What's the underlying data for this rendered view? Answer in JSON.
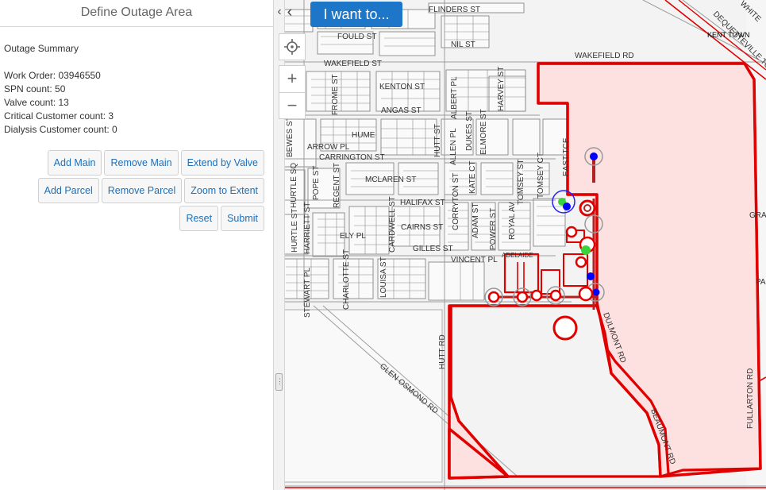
{
  "panel": {
    "title": "Define Outage Area",
    "summary_heading": "Outage Summary",
    "work_order": "Work Order: 03946550",
    "spn_count": "SPN count: 50",
    "valve_count": "Valve count: 13",
    "critical_count": "Critical Customer count: 3",
    "dialysis_count": "Dialysis Customer count: 0"
  },
  "buttons": {
    "add_main": "Add Main",
    "remove_main": "Remove Main",
    "extend_by_valve": "Extend by Valve",
    "add_parcel": "Add Parcel",
    "remove_parcel": "Remove Parcel",
    "zoom_to_extent": "Zoom to Extent",
    "reset": "Reset",
    "submit": "Submit"
  },
  "map": {
    "i_want_to": "I want to...",
    "icons": {
      "back": "chevron-left-icon",
      "locate": "crosshair-icon",
      "zoom_in": "plus-icon",
      "zoom_out": "minus-icon",
      "collapse": "chevron-left-icon",
      "grip": "grip-icon"
    },
    "colors": {
      "outage_fill": "#fde0e0",
      "outage_line": "#e00000",
      "button_blue": "#1d76c7",
      "valve_blue": "#0000ff",
      "valve_green": "#39d43c"
    },
    "street_labels": {
      "flinders": "FLINDERS ST",
      "fould": "FOULD ST",
      "nil": "NIL ST",
      "wakefield_st": "WAKEFIELD ST",
      "wakefield_rd": "WAKEFIELD RD",
      "kenton": "KENTON ST",
      "angas": "ANGAS ST",
      "frome": "FROME ST",
      "harvey": "HARVEY ST",
      "albert": "ALBERT PL",
      "hume": "HUME",
      "bewes": "BEWES ST",
      "arrow": "ARROW PL",
      "carrington": "CARRINGTON ST",
      "hutt": "HUTT ST",
      "allen": "ALLEN PL",
      "dukes": "DUKES ST",
      "elmore": "ELMORE ST",
      "east_tce": "EAST TCE",
      "mclaren": "MCLAREN ST",
      "hurtle_sq": "HURTLE SQ",
      "pope": "POPE ST",
      "regent": "REGENT ST",
      "halifax": "HALIFAX ST",
      "corryton": "CORRYTON ST",
      "katé": "KATE CT",
      "tomsey": "TOMSEY ST",
      "tomsey_court": "TOMSEY CT",
      "cairns": "CAIRNS ST",
      "adam": "ADAM ST",
      "hurtle_st": "HURTLE ST",
      "harriett": "HARRIETT ST",
      "ely": "ELY PL",
      "cardwell": "CARDWELL ST",
      "gilles": "GILLES ST",
      "power": "POWER ST",
      "royal": "ROYAL AV",
      "vincent": "VINCENT PL",
      "adelaide": "ADELAIDE",
      "stewart": "STEWART PL",
      "charlotte": "CHARLOTTE ST",
      "louisa": "LOUISA ST",
      "glen_osmond": "GLEN OSMOND RD",
      "hutt_rd": "HUTT RD",
      "dequetteville": "DEQUETTEVILLE TCE",
      "kent_town": "KENT TOWN",
      "fullarton": "FULLARTON RD",
      "beaumont": "BEAUMONT RD",
      "dulmont": "DULMONT RD",
      "white": "WHITE",
      "gra": "GRA",
      "pa": "PA"
    }
  }
}
